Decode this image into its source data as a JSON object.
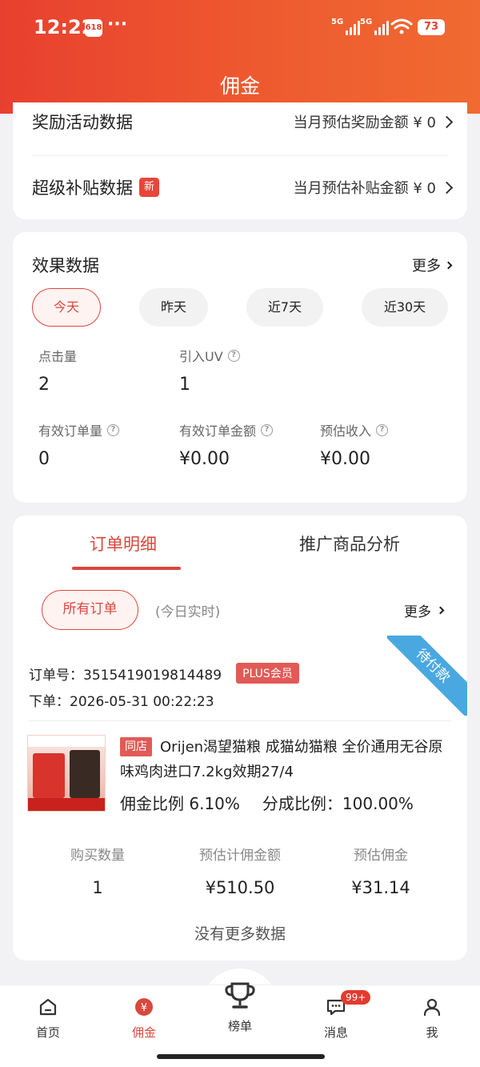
{
  "status_bar": {
    "time": "12:22",
    "app_badge": "618",
    "signal1_label": "5G",
    "signal2_label": "5G",
    "battery": "73"
  },
  "header": {
    "title": "佣金"
  },
  "reward_section": {
    "row1_title": "奖励活动数据",
    "row1_value": "当月预估奖励金额 ¥ 0",
    "row2_title": "超级补贴数据",
    "row2_badge": "新",
    "row2_value": "当月预估补贴金额 ¥ 0"
  },
  "effect": {
    "title": "效果数据",
    "more": "更多",
    "periods": [
      "今天",
      "昨天",
      "近7天",
      "近30天"
    ],
    "selected_period": "今天",
    "metrics": [
      {
        "label": "点击量",
        "value": "2",
        "help": false
      },
      {
        "label": "引入UV",
        "value": "1",
        "help": true
      },
      {
        "label": "有效订单量",
        "value": "0",
        "help": true
      },
      {
        "label": "有效订单金额",
        "value": "¥0.00",
        "help": true
      },
      {
        "label": "预估收入",
        "value": "¥0.00",
        "help": true
      }
    ]
  },
  "orders": {
    "tabs": [
      "订单明细",
      "推广商品分析"
    ],
    "active_tab": "订单明细",
    "filter_label": "所有订单",
    "realtime_label": "(今日实时)",
    "more": "更多",
    "order": {
      "status_ribbon": "待付款",
      "number_label": "订单号：",
      "number": "3515419019814489",
      "member_badge": "PLUS会员",
      "time_label": "下单：",
      "time": "2026-05-31 00:22:23",
      "shop_badge": "同店",
      "product_title": "Orijen渴望猫粮 成猫幼猫粮 全价通用无谷原味鸡肉进口7.2kg效期27/4",
      "commission_ratio_label": "佣金比例",
      "commission_ratio": "6.10%",
      "share_ratio_label": "分成比例：",
      "share_ratio": "100.00%",
      "stats": [
        {
          "label": "购买数量",
          "value": "1"
        },
        {
          "label": "预估计佣金额",
          "value": "¥510.50"
        },
        {
          "label": "预估佣金",
          "value": "¥31.14"
        }
      ]
    },
    "no_more": "没有更多数据"
  },
  "tabbar": {
    "items": [
      {
        "label": "首页",
        "icon": "home-icon"
      },
      {
        "label": "佣金",
        "icon": "commission-yen-icon"
      },
      {
        "label": "榜单",
        "icon": "trophy-icon"
      },
      {
        "label": "消息",
        "icon": "message-icon",
        "badge": "99+"
      },
      {
        "label": "我",
        "icon": "profile-icon"
      }
    ],
    "active": "佣金"
  },
  "colors": {
    "accent": "#d9483d",
    "header_start": "#e8402f",
    "header_end": "#f06a31",
    "ribbon": "#4aa8e0"
  }
}
